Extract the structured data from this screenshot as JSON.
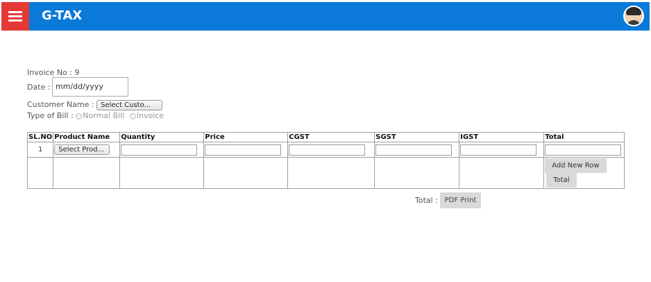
{
  "header": {
    "brand": "G-TAX",
    "accent_color": "#0a79d9",
    "menu_color": "#e53935",
    "menu_icon": "hamburger-icon",
    "avatar_icon": "user-avatar-icon"
  },
  "form": {
    "invoice_label": "Invoice No :",
    "invoice_no": "9",
    "date_label": "Date :",
    "date_placeholder": "mm/dd/yyyy",
    "customer_label": "Customer Name :",
    "customer_select": "Select Custo...",
    "bill_type_label": "Type of Bill :",
    "bill_type_options": [
      "Normal Bill",
      "Invoice"
    ]
  },
  "table": {
    "headers": [
      "SL.NO",
      "Product Name",
      "Quantity",
      "Price",
      "CGST",
      "SGST",
      "IGST",
      "Total"
    ],
    "rows": [
      {
        "sl_no": "1",
        "product_select": "Select Prod..."
      }
    ],
    "add_row_label": "Add New Row",
    "total_button_label": "Total"
  },
  "footer": {
    "total_label": "Total :",
    "pdf_print_label": "PDF Print"
  }
}
